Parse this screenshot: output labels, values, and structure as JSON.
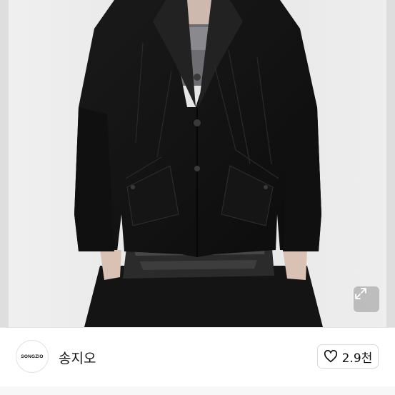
{
  "product": {
    "image_alt": "black jacket product photo",
    "expand_icon": "expand-arrows-icon"
  },
  "brand": {
    "logo_text": "SONGZIO",
    "name": "송지오"
  },
  "like": {
    "icon": "heart-outline-icon",
    "count": "2.9천"
  }
}
